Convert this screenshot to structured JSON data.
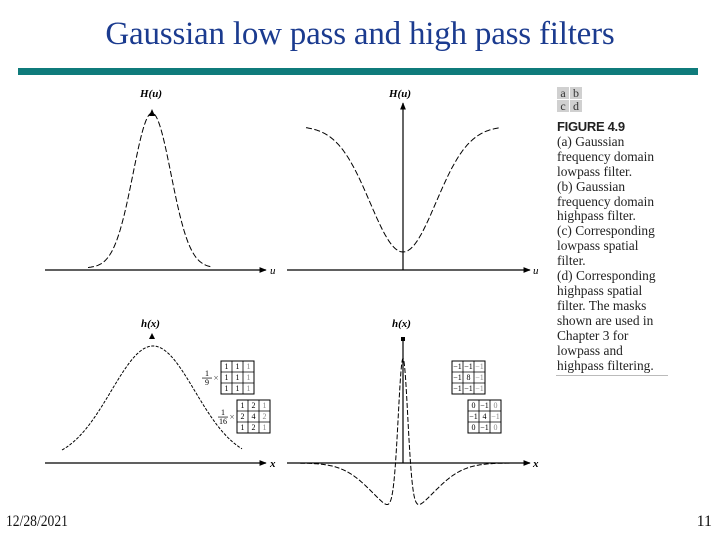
{
  "slide": {
    "title": "Gaussian low pass and high pass filters",
    "accent_color": "#0f7b7b",
    "title_color": "#1b3b8f",
    "footer": {
      "date": "12/28/2021",
      "page_number": "11"
    }
  },
  "figure": {
    "panel_labels": [
      "a",
      "b",
      "c",
      "d"
    ],
    "caption": {
      "heading": "FIGURE 4.9",
      "lines": [
        "(a) Gaussian",
        "frequency domain",
        "lowpass filter.",
        "(b) Gaussian",
        "frequency domain",
        "highpass filter.",
        "(c) Corresponding",
        "lowpass spatial",
        "filter.",
        "(d) Corresponding",
        "highpass spatial",
        "filter. The masks",
        "shown are used in",
        "Chapter 3 for",
        "lowpass and",
        "highpass filtering."
      ]
    },
    "panels": {
      "a": {
        "y_label": "H(u)",
        "x_label": "u",
        "curve": "gaussian-lowpass"
      },
      "b": {
        "y_label": "H(u)",
        "x_label": "u",
        "curve": "gaussian-highpass"
      },
      "c": {
        "y_label": "h(x)",
        "x_label": "x",
        "curve": "gaussian-spatial",
        "masks": [
          {
            "scale_num": "1",
            "scale_den": "9",
            "times": "×",
            "cells": [
              [
                "1",
                "1",
                "1"
              ],
              [
                "1",
                "1",
                "1"
              ],
              [
                "1",
                "1",
                "1"
              ]
            ]
          },
          {
            "scale_num": "1",
            "scale_den": "16",
            "times": "×",
            "cells": [
              [
                "1",
                "2",
                "1"
              ],
              [
                "2",
                "4",
                "2"
              ],
              [
                "1",
                "2",
                "1"
              ]
            ]
          }
        ]
      },
      "d": {
        "y_label": "h(x)",
        "x_label": "x",
        "curve": "highpass-spatial",
        "masks": [
          {
            "cells": [
              [
                "−1",
                "−1",
                "−1"
              ],
              [
                "−1",
                "8",
                "−1"
              ],
              [
                "−1",
                "−1",
                "−1"
              ]
            ]
          },
          {
            "cells": [
              [
                "0",
                "−1",
                "0"
              ],
              [
                "−1",
                "4",
                "−1"
              ],
              [
                "0",
                "−1",
                "0"
              ]
            ]
          }
        ]
      }
    }
  }
}
